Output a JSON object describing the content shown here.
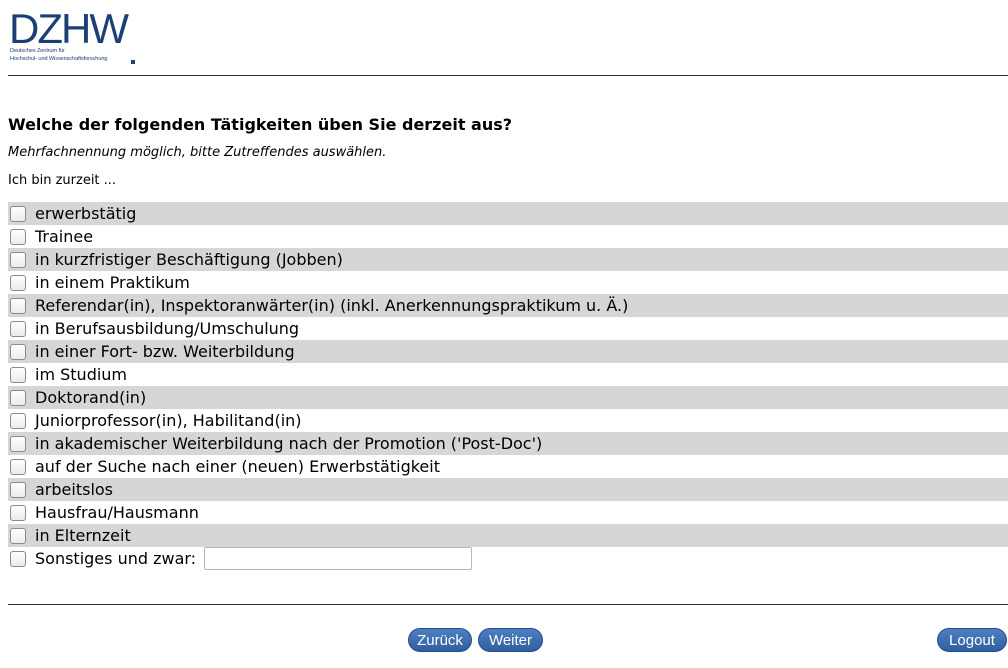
{
  "logo": {
    "wordmark": "DZHW",
    "line1": "Deutsches Zentrum für",
    "line2": "Hochschul- und Wissenschaftsforschung",
    "color": "#1c3f77"
  },
  "question": {
    "title": "Welche der folgenden Tätigkeiten üben Sie derzeit aus?",
    "hint": "Mehrfachnennung möglich, bitte Zutreffendes auswählen.",
    "lead": "Ich bin zurzeit ..."
  },
  "options": [
    {
      "label": "erwerbstätig",
      "checked": false
    },
    {
      "label": "Trainee",
      "checked": false
    },
    {
      "label": "in kurzfristiger Beschäftigung (Jobben)",
      "checked": false
    },
    {
      "label": "in einem Praktikum",
      "checked": false
    },
    {
      "label": "Referendar(in), Inspektoranwärter(in) (inkl. Anerkennungspraktikum u. Ä.)",
      "checked": false
    },
    {
      "label": "in Berufsausbildung/Umschulung",
      "checked": false
    },
    {
      "label": "in einer Fort- bzw. Weiterbildung",
      "checked": false
    },
    {
      "label": "im Studium",
      "checked": false
    },
    {
      "label": "Doktorand(in)",
      "checked": false
    },
    {
      "label": "Juniorprofessor(in), Habilitand(in)",
      "checked": false
    },
    {
      "label": "in akademischer Weiterbildung nach der Promotion ('Post-Doc')",
      "checked": false
    },
    {
      "label": "auf der Suche nach einer (neuen) Erwerbstätigkeit",
      "checked": false
    },
    {
      "label": "arbeitslos",
      "checked": false
    },
    {
      "label": "Hausfrau/Hausmann",
      "checked": false
    },
    {
      "label": "in Elternzeit",
      "checked": false
    },
    {
      "label": "Sonstiges und zwar:",
      "checked": false,
      "other_value": ""
    }
  ],
  "buttons": {
    "back": "Zurück",
    "next": "Weiter",
    "logout": "Logout"
  },
  "colors": {
    "button": "#2f5f9f",
    "row_shade": "#d6d6d6"
  }
}
